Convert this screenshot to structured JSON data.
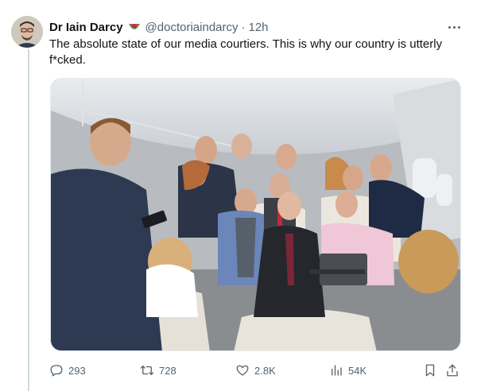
{
  "tweet": {
    "author_name": "Dr Iain Darcy",
    "author_handle": "@doctoriaindarcy",
    "separator": "·",
    "time": "12h",
    "name_emoji": "watermelon-icon",
    "text": "The absolute state of our media courtiers. This is why our country is utterly f*cked.",
    "media": {
      "description_icon": "photo-icon"
    }
  },
  "actions": {
    "replies": "293",
    "reposts": "728",
    "likes": "2.8K",
    "views": "54K"
  },
  "icons": {
    "reply": "reply-icon",
    "retweet": "retweet-icon",
    "like": "heart-icon",
    "views": "bar-chart-icon",
    "bookmark": "bookmark-icon",
    "share": "share-icon",
    "more": "more-icon"
  },
  "colors": {
    "text": "#0f1419",
    "secondary": "#536471",
    "thread_line": "#cfd9de"
  }
}
